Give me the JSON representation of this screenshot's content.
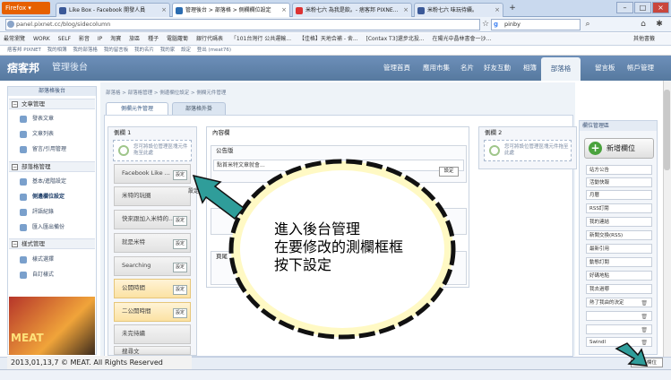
{
  "browser": {
    "app_button": "Firefox ▾",
    "tabs": [
      {
        "title": "Like Box - Facebook 開發人員",
        "active": false
      },
      {
        "title": "管理後台 > 部落格 > 側欄欄位設定",
        "active": true
      },
      {
        "title": "米粉七六 為我是飲。- 痞客邦 PIXNE...",
        "active": false
      },
      {
        "title": "米粉七六 味玩待續。",
        "active": false
      }
    ],
    "new_tab": "+",
    "url": "panel.pixnet.cc/blog/sidecolumn",
    "search_value": "pinby",
    "bookmarks": [
      "最常瀏覽",
      "WORK",
      "SELF",
      "影音",
      "IP",
      "淘寶",
      "旅區",
      "種子",
      "電腦蘿蔔",
      "銀行代碼表",
      "「101台灣行 公共運輸...",
      "【佳格】天地合補 - 舍...",
      "[Contax T3]還步北投...",
      "在陽光中晶林書會一沙...",
      "其他書籤"
    ],
    "sitebar": [
      "痞客邦 PIXNET",
      "我的相簿",
      "我的部落格",
      "我的留言板",
      "我的名片",
      "我的家",
      "設定",
      "登出 (meat76)"
    ]
  },
  "header": {
    "logo": "痞客邦",
    "subtitle": "管理後台",
    "nav": [
      "管理首頁",
      "應用市集",
      "名片",
      "好友互動",
      "相簿",
      "部落格",
      "留言板",
      "帳戶管理"
    ],
    "active_nav": "部落格"
  },
  "sidebar": {
    "title": "部落格後台",
    "groups": [
      {
        "title": "文章管理",
        "items": [
          "發表文章",
          "文章列表",
          "留言/引用管理"
        ]
      },
      {
        "title": "部落格管理",
        "items": [
          "基本/進階設定",
          "側邊欄位設定",
          "評語紀錄",
          "匯入匯出備份"
        ]
      },
      {
        "title": "樣式管理",
        "items": [
          "樣式選擇",
          "自訂樣式"
        ]
      }
    ]
  },
  "main": {
    "breadcrumb": "部落格 > 部落格管理 > 側邊欄位設定 > 側欄元件管理",
    "tabs": [
      "側欄元件管理",
      "部落格外掛"
    ],
    "col1": {
      "title": "側欄 1",
      "drop_hint": "您可將設位管理區塊元件拖至此處",
      "widgets": [
        {
          "label": "Facebook Like ...",
          "highlight": false
        },
        {
          "label": "米特的玩圈",
          "highlight": false
        },
        {
          "label": "快來跟加入米特的...",
          "highlight": false
        },
        {
          "label": "就是米特",
          "highlight": false
        },
        {
          "label": "Searching",
          "highlight": false
        },
        {
          "label": "公開時間",
          "highlight": true
        },
        {
          "label": "二公開時間",
          "highlight": true
        },
        {
          "label": "未完待續",
          "highlight": false
        },
        {
          "label": "搜尋文",
          "highlight": false
        }
      ],
      "set_label": "設定"
    },
    "col2": {
      "title": "內容欄",
      "box1_title": "公告版",
      "box1_field": "點首米特文章就會...",
      "box1_btn": "設定",
      "box3_title": "頁尾"
    },
    "col3": {
      "title": "側欄 2",
      "drop_hint": "您可將設位管理區塊元件拖至此處"
    }
  },
  "right_panel": {
    "title": "欄位管理區",
    "add_button": "新增欄位",
    "items": [
      "站方公告",
      "活動快報",
      "月曆",
      "RSS訂閱",
      "我的連結",
      "新聞交換(RSS)",
      "最新引用",
      "動態訂閱",
      "好碼地點",
      "我去過哪",
      "熱了我由的決定",
      "",
      "",
      "",
      "Swindl"
    ]
  },
  "callout": {
    "line1": "進入後台管理",
    "line2": "在要修改的測欄框框",
    "line3": "按下設定"
  },
  "footer": {
    "copyright": "2013,01,13,7 © MEAT. All Rights Reserved",
    "save_button": "儲存欄位"
  },
  "promo_label": "MEAT"
}
